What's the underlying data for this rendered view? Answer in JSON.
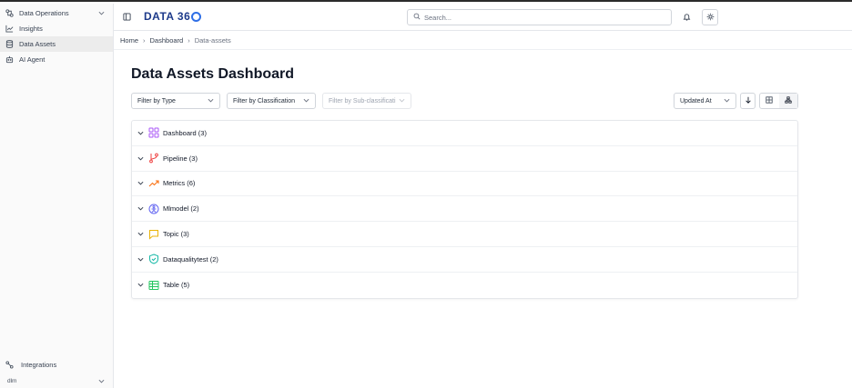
{
  "sidebar": {
    "workspace_label": "Data Operations",
    "items": [
      {
        "label": "Insights",
        "icon": "line-chart-icon"
      },
      {
        "label": "Data Assets",
        "icon": "database-icon",
        "active": true
      },
      {
        "label": "AI Agent",
        "icon": "bot-icon"
      }
    ],
    "bottom": {
      "integrations_label": "Integrations",
      "user_label": "dlm"
    }
  },
  "header": {
    "logo_text": "DATA 36",
    "search_placeholder": "Search..."
  },
  "breadcrumb": [
    "Home",
    "Dashboard",
    "Data-assets"
  ],
  "page_title": "Data Assets Dashboard",
  "filters": {
    "type": "Filter by Type",
    "classification": "Filter by Classification",
    "subclassification": "Filter by Sub-classificati",
    "sort": "Updated At"
  },
  "groups": [
    {
      "label": "Dashboard (3)",
      "color": "#a855f7"
    },
    {
      "label": "Pipeline (3)",
      "color": "#ef4444"
    },
    {
      "label": "Metrics (6)",
      "color": "#f97316"
    },
    {
      "label": "Mlmodel (2)",
      "color": "#6366f1"
    },
    {
      "label": "Topic (3)",
      "color": "#eab308"
    },
    {
      "label": "Dataqualitytest (2)",
      "color": "#14b8a6"
    },
    {
      "label": "Table (5)",
      "color": "#22c55e"
    }
  ]
}
